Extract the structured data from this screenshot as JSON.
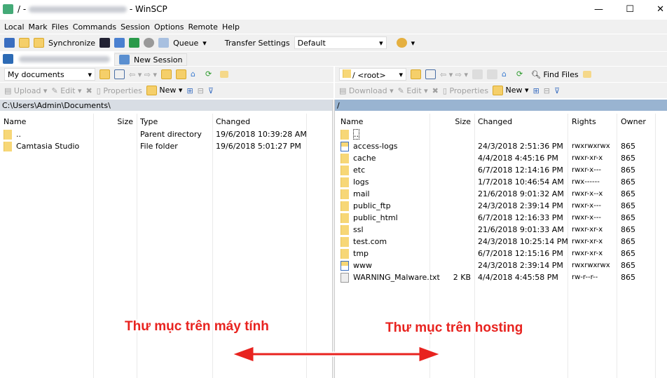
{
  "window": {
    "title_prefix": "/ -",
    "title_suffix": "- WinSCP",
    "controls": [
      "—",
      "☐",
      "✕"
    ]
  },
  "menu": [
    "Local",
    "Mark",
    "Files",
    "Commands",
    "Session",
    "Options",
    "Remote",
    "Help"
  ],
  "toolbar": {
    "synchronize": "Synchronize",
    "queue": "Queue",
    "transfer_settings_label": "Transfer Settings",
    "transfer_settings_value": "Default"
  },
  "tabs": {
    "new_session": "New Session"
  },
  "left": {
    "location": "My documents",
    "upload": "Upload",
    "edit": "Edit",
    "properties": "Properties",
    "new": "New",
    "path": "C:\\Users\\Admin\\Documents\\",
    "columns": [
      "Name",
      "Size",
      "Type",
      "Changed"
    ],
    "rows": [
      {
        "name": "..",
        "size": "",
        "type": "Parent directory",
        "changed": "19/6/2018 10:39:28 AM"
      },
      {
        "name": "Camtasia Studio",
        "size": "",
        "type": "File folder",
        "changed": "19/6/2018 5:01:27 PM"
      }
    ]
  },
  "right": {
    "location": "/ <root>",
    "find_files": "Find Files",
    "download": "Download",
    "edit": "Edit",
    "properties": "Properties",
    "new": "New",
    "path": "/",
    "columns": [
      "Name",
      "Size",
      "Changed",
      "Rights",
      "Owner"
    ],
    "rows": [
      {
        "name": "..",
        "size": "",
        "changed": "",
        "rights": "",
        "owner": "",
        "icon": "parent"
      },
      {
        "name": "access-logs",
        "size": "",
        "changed": "24/3/2018 2:51:36 PM",
        "rights": "rwxrwxrwx",
        "owner": "865",
        "icon": "link"
      },
      {
        "name": "cache",
        "size": "",
        "changed": "4/4/2018 4:45:16 PM",
        "rights": "rwxr-xr-x",
        "owner": "865",
        "icon": "folder"
      },
      {
        "name": "etc",
        "size": "",
        "changed": "6/7/2018 12:14:16 PM",
        "rights": "rwxr-x---",
        "owner": "865",
        "icon": "folder"
      },
      {
        "name": "logs",
        "size": "",
        "changed": "1/7/2018 10:46:54 AM",
        "rights": "rwx------",
        "owner": "865",
        "icon": "folder"
      },
      {
        "name": "mail",
        "size": "",
        "changed": "21/6/2018 9:01:32 AM",
        "rights": "rwxr-x--x",
        "owner": "865",
        "icon": "folder"
      },
      {
        "name": "public_ftp",
        "size": "",
        "changed": "24/3/2018 2:39:14 PM",
        "rights": "rwxr-x---",
        "owner": "865",
        "icon": "folder"
      },
      {
        "name": "public_html",
        "size": "",
        "changed": "6/7/2018 12:16:33 PM",
        "rights": "rwxr-x---",
        "owner": "865",
        "icon": "folder"
      },
      {
        "name": "ssl",
        "size": "",
        "changed": "21/6/2018 9:01:33 AM",
        "rights": "rwxr-xr-x",
        "owner": "865",
        "icon": "folder"
      },
      {
        "name": "test.com",
        "size": "",
        "changed": "24/3/2018 10:25:14 PM",
        "rights": "rwxr-xr-x",
        "owner": "865",
        "icon": "folder"
      },
      {
        "name": "tmp",
        "size": "",
        "changed": "6/7/2018 12:15:16 PM",
        "rights": "rwxr-xr-x",
        "owner": "865",
        "icon": "folder"
      },
      {
        "name": "www",
        "size": "",
        "changed": "24/3/2018 2:39:14 PM",
        "rights": "rwxrwxrwx",
        "owner": "865",
        "icon": "link"
      },
      {
        "name": "WARNING_Malware.txt",
        "size": "2 KB",
        "changed": "4/4/2018 4:45:58 PM",
        "rights": "rw-r--r--",
        "owner": "865",
        "icon": "file"
      }
    ]
  },
  "annotations": {
    "local": "Thư mục trên máy tính",
    "remote": "Thư mục trên hosting",
    "color": "#e8231f"
  }
}
